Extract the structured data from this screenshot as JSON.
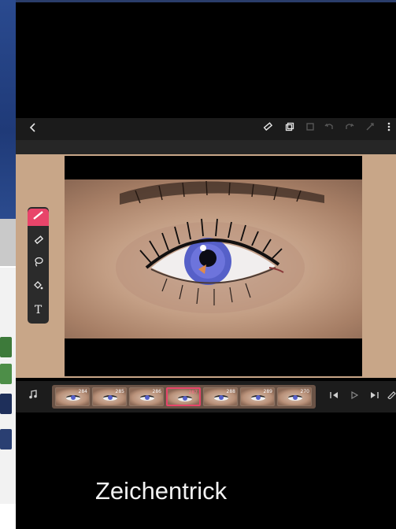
{
  "toolbar": {
    "back_icon": "chevron-left-icon",
    "icons": [
      "eraser-icon",
      "copy-layer-icon",
      "paste-icon",
      "undo-icon",
      "redo-icon",
      "transform-icon",
      "more-icon"
    ]
  },
  "tools": [
    "brush-icon",
    "eraser-icon",
    "lasso-icon",
    "fill-bucket-icon",
    "text-icon"
  ],
  "tool_text_glyph": "T",
  "timeline": {
    "frames": [
      {
        "number": "284",
        "selected": false
      },
      {
        "number": "285",
        "selected": false
      },
      {
        "number": "286",
        "selected": false
      },
      {
        "number": "287",
        "selected": true
      },
      {
        "number": "288",
        "selected": false
      },
      {
        "number": "289",
        "selected": false
      },
      {
        "number": "270",
        "selected": false
      }
    ]
  },
  "caption": "Zeichentrick",
  "colors": {
    "accent": "#e8456a",
    "toolbar": "#1b1b1b",
    "canvas_background": "#c8a688",
    "iris": "#5660c8"
  }
}
